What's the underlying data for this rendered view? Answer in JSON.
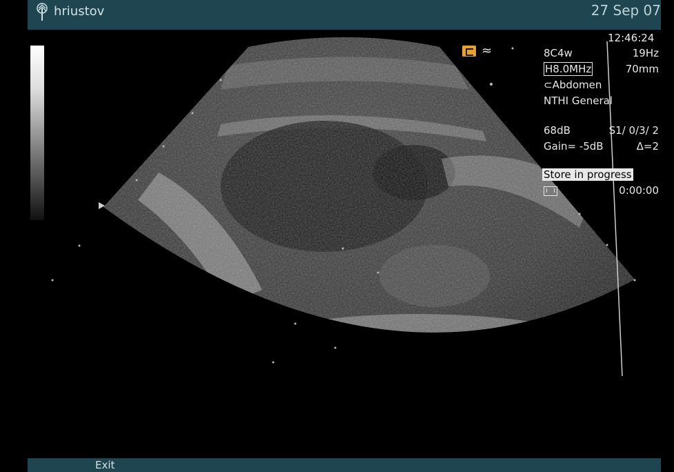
{
  "header": {
    "user": "hriustov",
    "date": "27 Sep 07",
    "logo_icon": "tree-logo-icon"
  },
  "info_panel": {
    "time": "12:46:24",
    "probe": "8C4w",
    "frame_rate": "19Hz",
    "frequency": "H8.0MHz",
    "depth": "70mm",
    "preset": "Abdomen",
    "mode": "NTHI General",
    "dynamic_range": "68dB",
    "settings": "S1/ 0/3/ 2",
    "gain": "Gain= -5dB",
    "delta": "Δ=2",
    "store_status": "Store in progress",
    "timer": "0:00:00"
  },
  "footer": {
    "exit_label": "Exit"
  },
  "colors": {
    "bar": "#1f4650",
    "accent": "#e8a030"
  }
}
